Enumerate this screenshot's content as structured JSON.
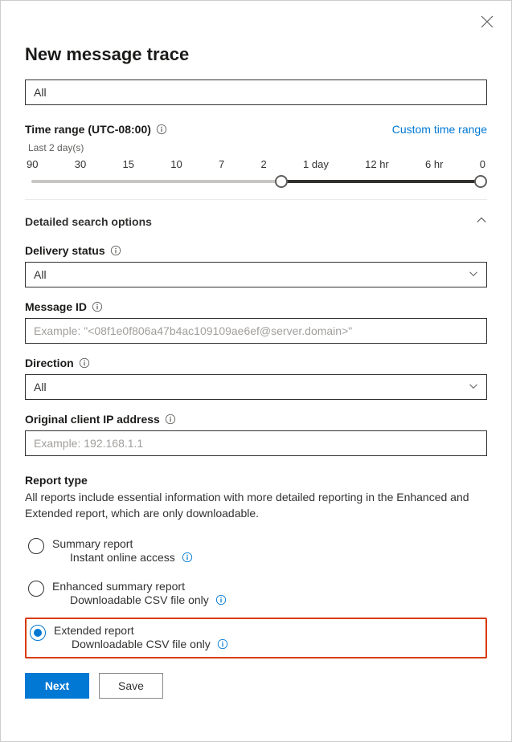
{
  "title": "New message trace",
  "top_input_value": "All",
  "close_label": "Close",
  "time_range": {
    "label": "Time range (UTC-08:00)",
    "custom_link": "Custom time range",
    "caption": "Last 2 day(s)",
    "ticks": [
      "90",
      "30",
      "15",
      "10",
      "7",
      "2",
      "1 day",
      "12 hr",
      "6 hr",
      "0"
    ],
    "start_index": 5,
    "end_index": 9
  },
  "detailed_header": "Detailed search options",
  "fields": {
    "delivery_status": {
      "label": "Delivery status",
      "value": "All"
    },
    "message_id": {
      "label": "Message ID",
      "placeholder": "Example: \"<08f1e0f806a47b4ac109109ae6ef@server.domain>\""
    },
    "direction": {
      "label": "Direction",
      "value": "All"
    },
    "client_ip": {
      "label": "Original client IP address",
      "placeholder": "Example: 192.168.1.1"
    }
  },
  "report": {
    "header": "Report type",
    "description": "All reports include essential information with more detailed reporting in the Enhanced and Extended report, which are only downloadable.",
    "options": [
      {
        "title": "Summary report",
        "sub": "Instant online access",
        "checked": false,
        "highlighted": false
      },
      {
        "title": "Enhanced summary report",
        "sub": "Downloadable CSV file only",
        "checked": false,
        "highlighted": false
      },
      {
        "title": "Extended report",
        "sub": "Downloadable CSV file only",
        "checked": true,
        "highlighted": true
      }
    ]
  },
  "buttons": {
    "next": "Next",
    "save": "Save"
  }
}
